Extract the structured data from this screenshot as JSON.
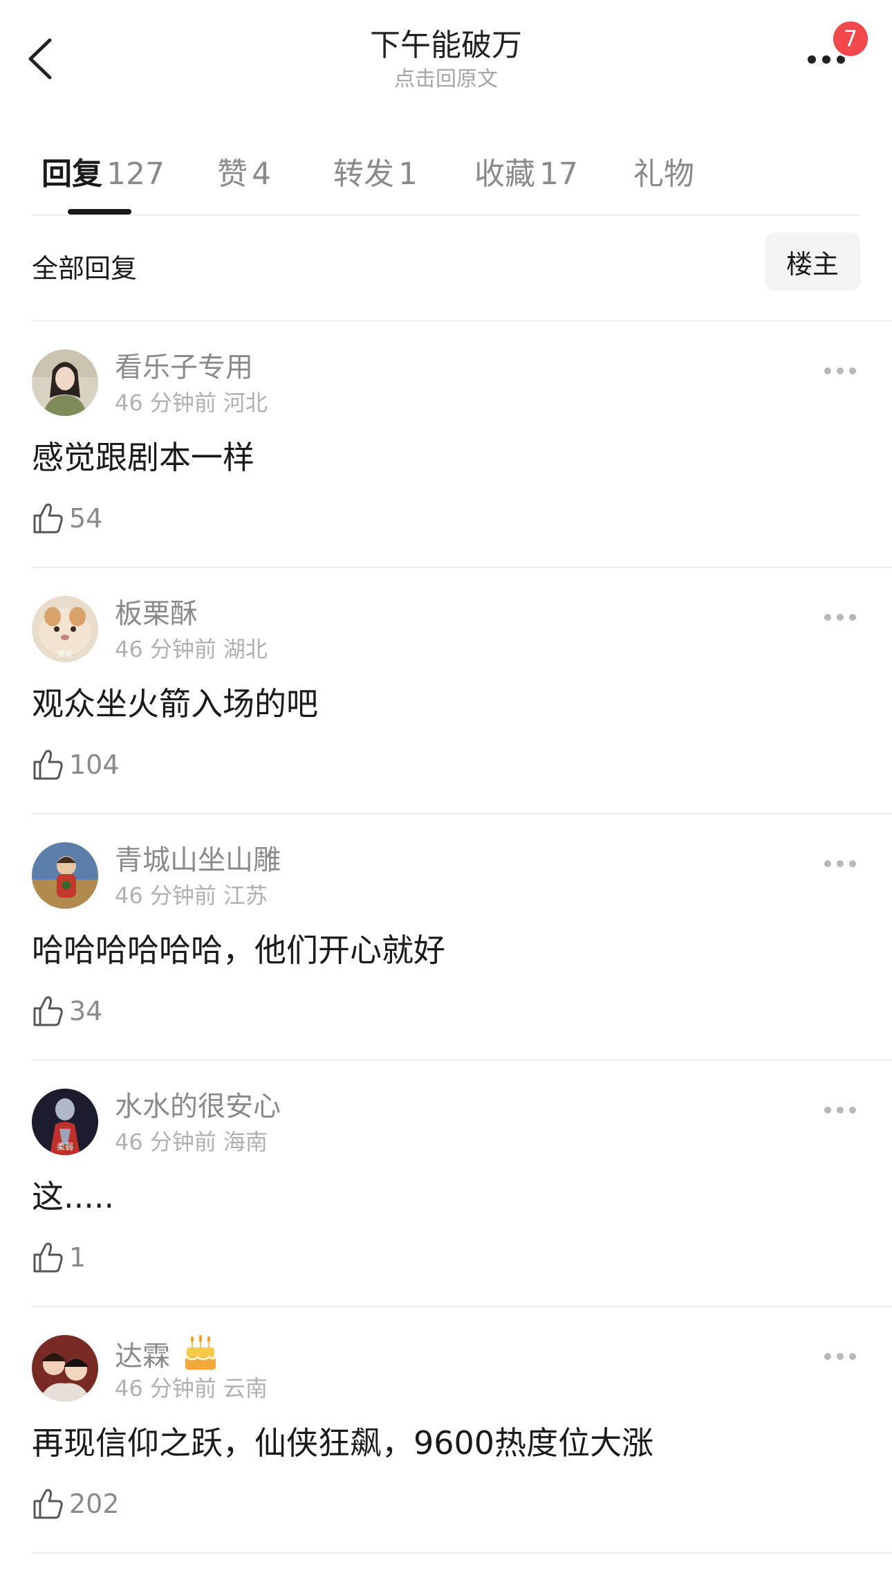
{
  "header": {
    "title": "下午能破万",
    "subtitle": "点击回原文",
    "badge_count": "7",
    "icons": {
      "back": "chevron-left-icon",
      "more": "more-icon"
    }
  },
  "tabs": [
    {
      "label": "回复",
      "count": "127",
      "active": true
    },
    {
      "label": "赞",
      "count": "4"
    },
    {
      "label": "转发",
      "count": "1"
    },
    {
      "label": "收藏",
      "count": "17"
    },
    {
      "label": "礼物",
      "count": ""
    }
  ],
  "filter": {
    "label": "全部回复",
    "op_button": "楼主"
  },
  "comments": [
    {
      "username": "看乐子专用",
      "time": "46 分钟前",
      "location": "河北",
      "text": "感觉跟剧本一样",
      "likes": "54",
      "avatar_caption": ""
    },
    {
      "username": "板栗酥",
      "time": "46 分钟前",
      "location": "湖北",
      "text": "观众坐火箭入场的吧",
      "likes": "104",
      "avatar_caption": "思索"
    },
    {
      "username": "青城山坐山雕",
      "time": "46 分钟前",
      "location": "江苏",
      "text": "哈哈哈哈哈哈，他们开心就好",
      "likes": "34",
      "avatar_caption": ""
    },
    {
      "username": "水水的很安心",
      "time": "46 分钟前",
      "location": "海南",
      "text": "这.....",
      "likes": "1",
      "avatar_caption": "柔弱"
    },
    {
      "username": "达霖",
      "time": "46 分钟前",
      "location": "云南",
      "text": "再现信仰之跃，仙侠狂飙，9600热度位大涨",
      "likes": "202",
      "avatar_caption": "",
      "badge_icon": "birthday-cake-icon"
    }
  ],
  "colors": {
    "badge": "#f2474b",
    "text_primary": "#1a1a1a",
    "text_secondary": "#8a8a8a",
    "text_meta": "#b0b0b0",
    "divider": "#ededed"
  }
}
